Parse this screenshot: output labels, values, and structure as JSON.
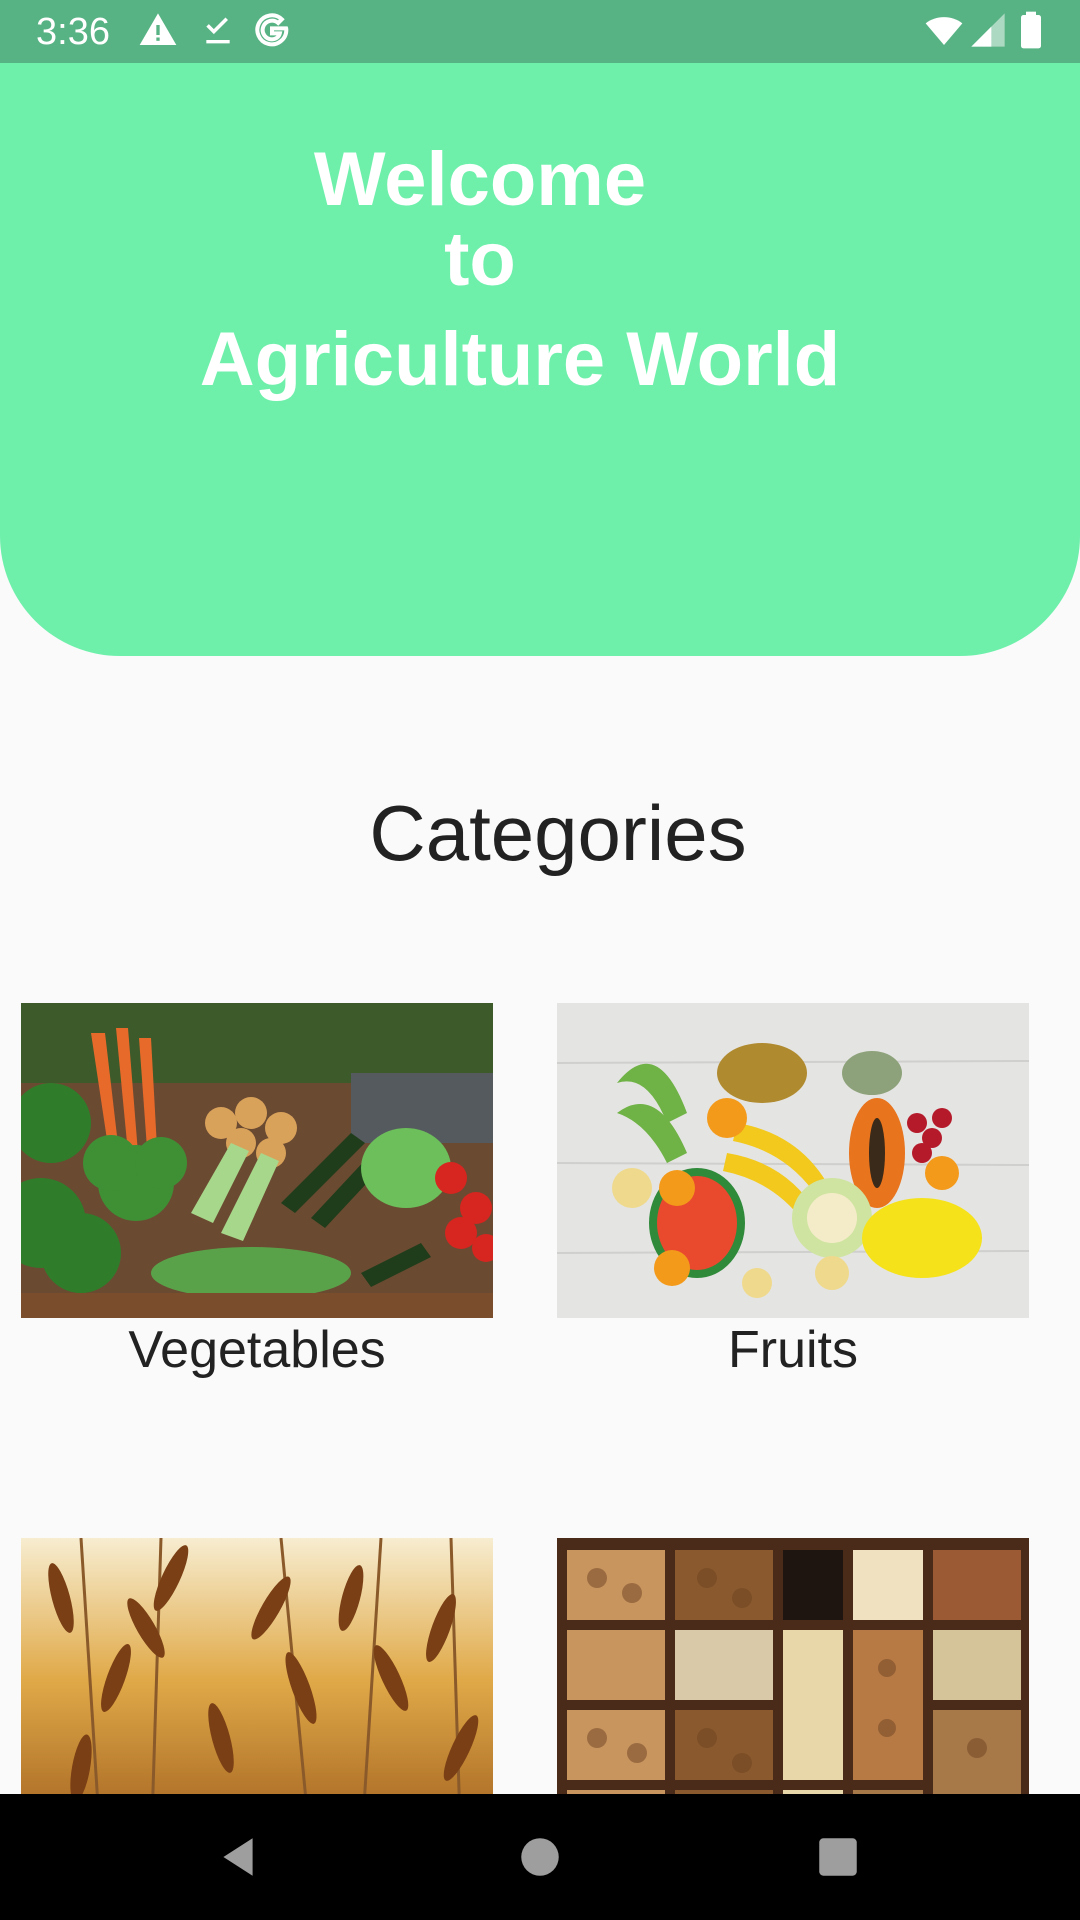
{
  "status_bar": {
    "time": "3:36",
    "icons_left": [
      "warning-icon",
      "download-done-icon",
      "google-g-icon"
    ],
    "icons_right": [
      "wifi-icon",
      "signal-icon",
      "battery-icon"
    ]
  },
  "header": {
    "line1": "Welcome",
    "line2": "to",
    "line3": "Agriculture World",
    "color": "#6ef0ab"
  },
  "categories": {
    "title": "Categories",
    "items": [
      {
        "label": "Vegetables",
        "image": "vegetables-image"
      },
      {
        "label": "Fruits",
        "image": "fruits-image"
      },
      {
        "label": "",
        "image": "pulses-image"
      },
      {
        "label": "",
        "image": "dry-fruits-image"
      }
    ]
  },
  "nav_bar": {
    "buttons": [
      "back-icon",
      "home-icon",
      "recents-icon"
    ]
  }
}
